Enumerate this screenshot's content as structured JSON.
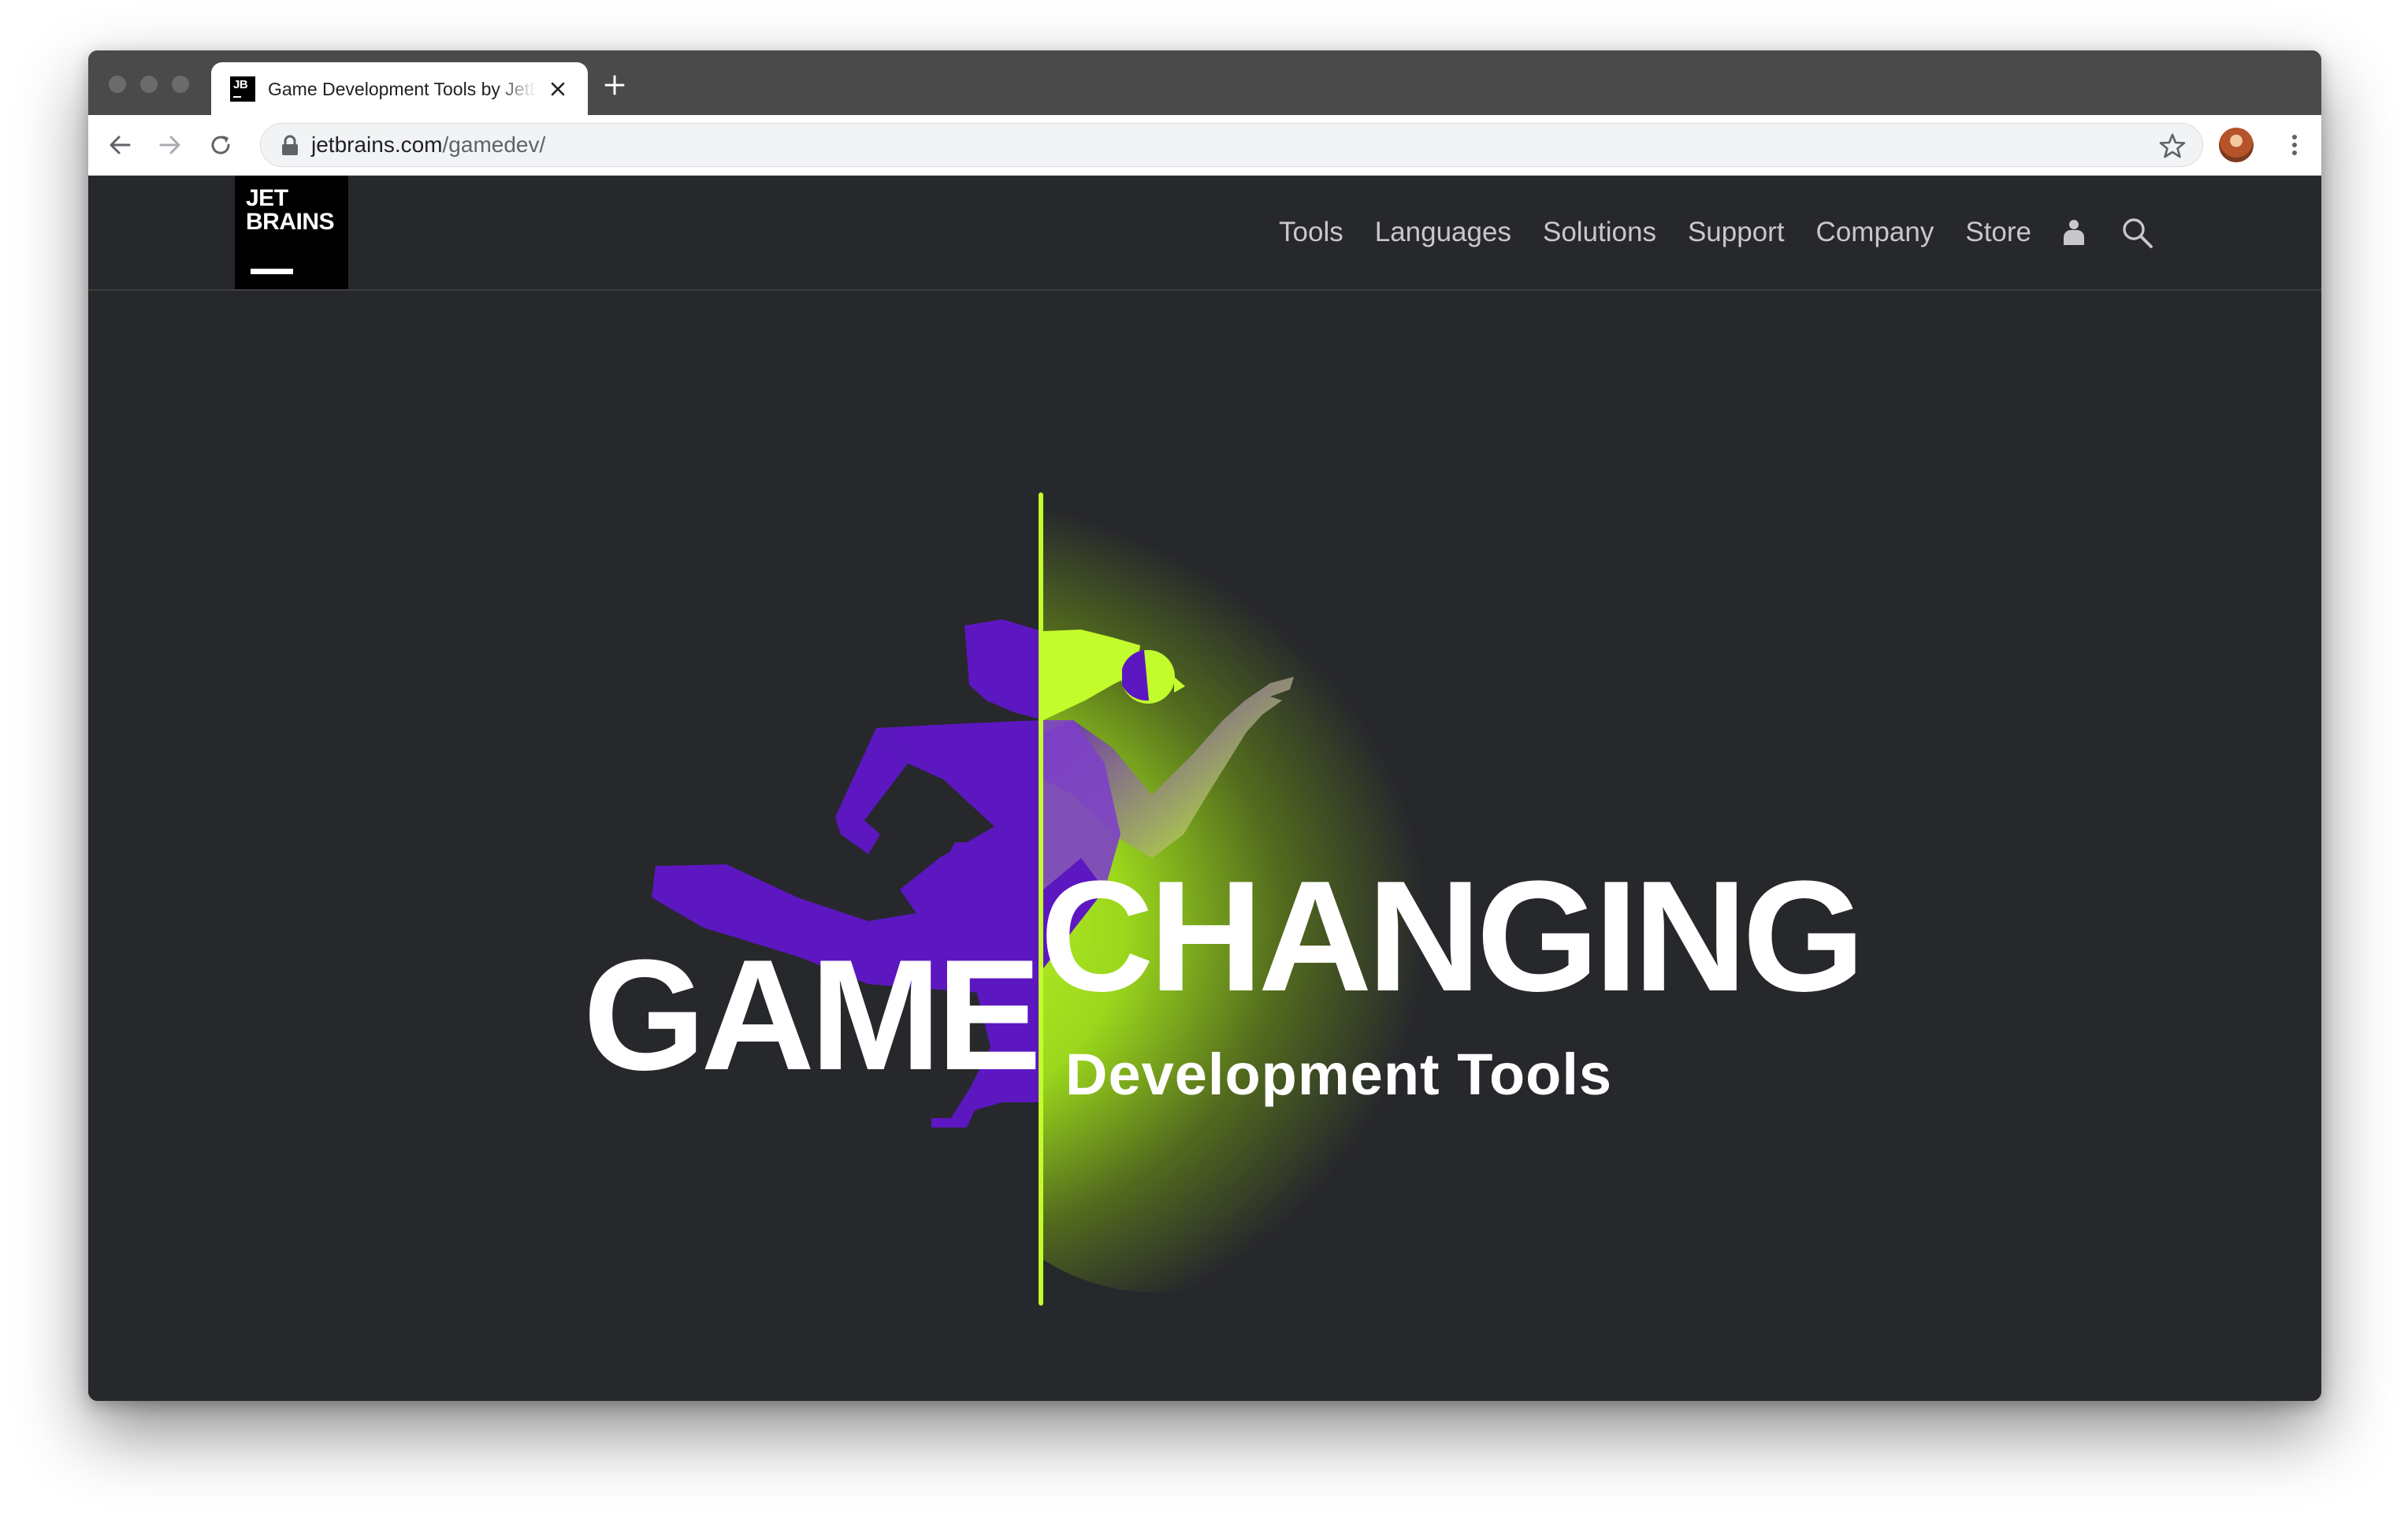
{
  "browser": {
    "tab_title": "Game Development Tools by JetBrains",
    "tab_favicon_text": "JB",
    "url_host": "jetbrains.com",
    "url_path": "/gamedev/"
  },
  "site": {
    "logo_line1": "JET",
    "logo_line2": "BRAINS",
    "nav": [
      "Tools",
      "Languages",
      "Solutions",
      "Support",
      "Company",
      "Store"
    ],
    "icons": [
      "user-icon",
      "search-icon"
    ]
  },
  "hero": {
    "word_left": "GAME",
    "word_right": "CHANGING",
    "subtitle": "Development Tools"
  },
  "colors": {
    "page_bg": "#27282c",
    "accent_lime": "#c3fc2c",
    "accent_purple": "#5c17c0",
    "text": "#ffffff",
    "nav_text": "#c8c8cc"
  }
}
